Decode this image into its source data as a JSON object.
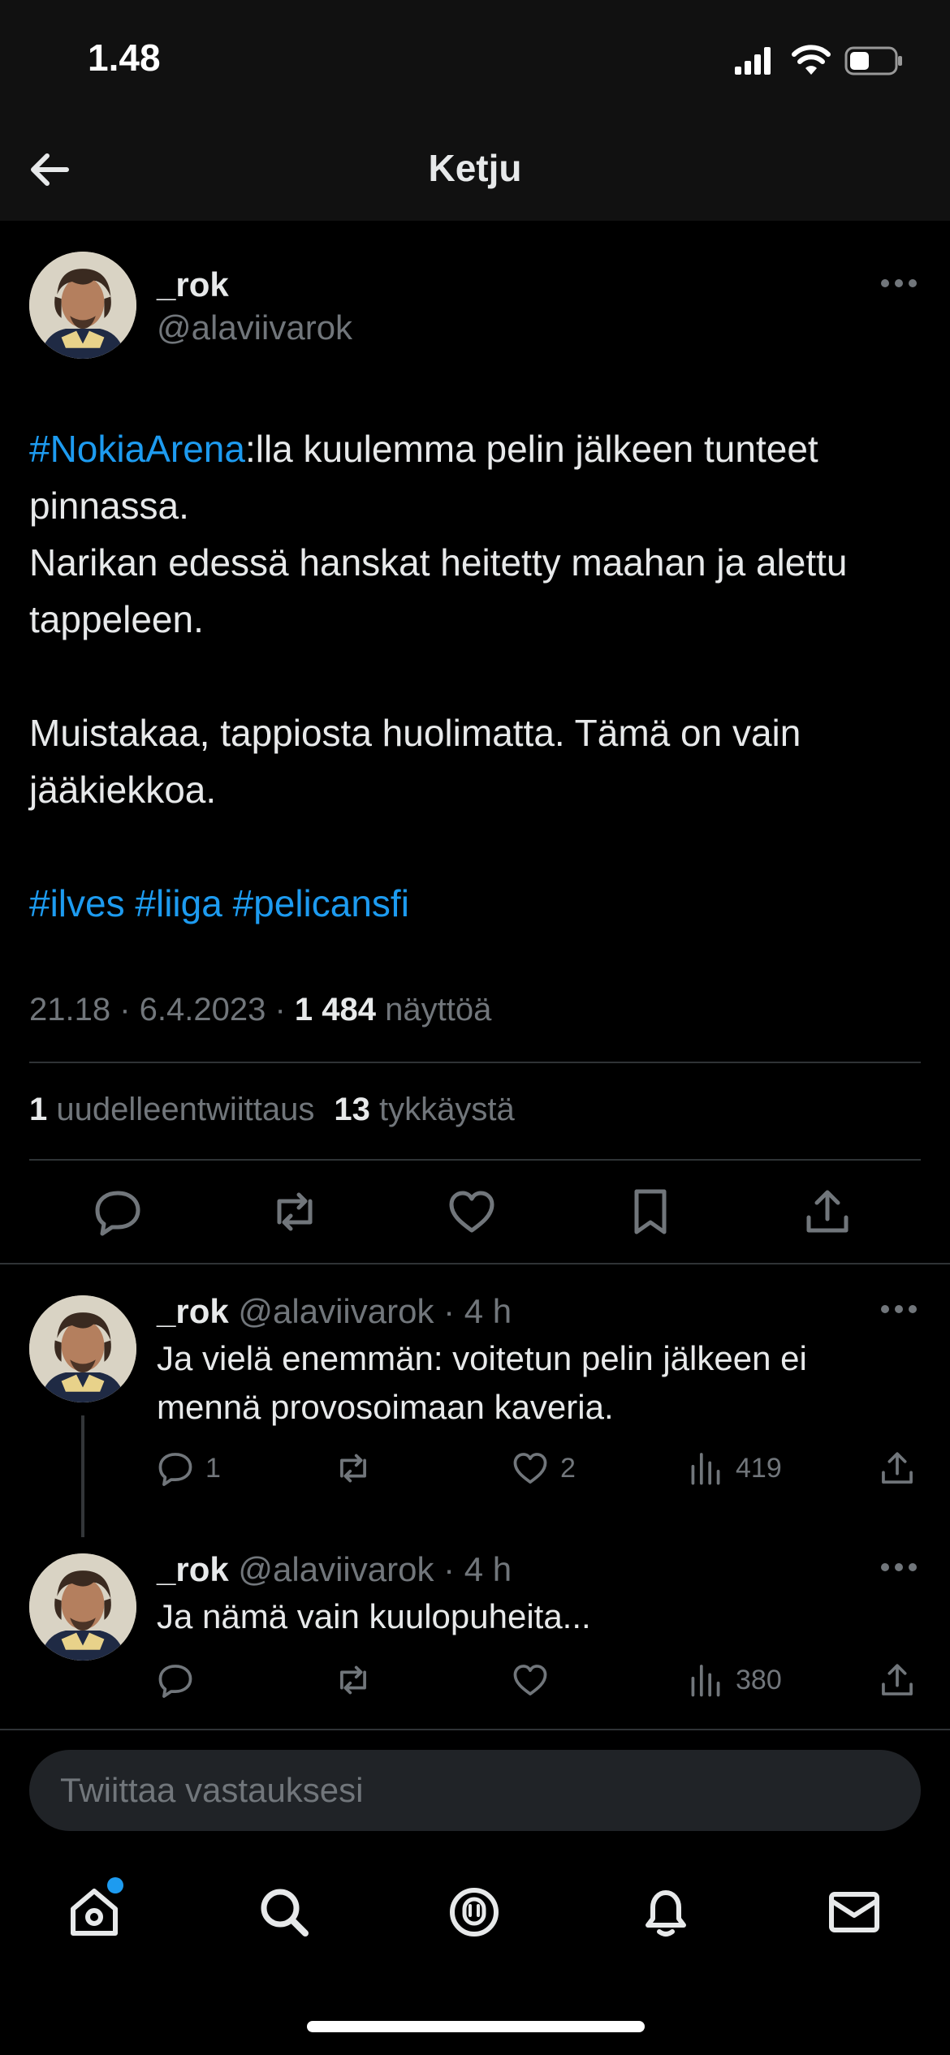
{
  "status_bar": {
    "time": "1.48",
    "battery_level": 0.45
  },
  "header": {
    "title": "Ketju",
    "back_icon": "arrow-left-icon"
  },
  "main_tweet": {
    "name": "_rok",
    "handle": "@alaviivarok",
    "text_parts": {
      "p1_hashtag": "#NokiaArena",
      "p1_text": ":lla kuulemma pelin jälkeen tunteet pinnassa.",
      "p2": "Narikan edessä hanskat heitetty maahan ja alettu tappeleen.",
      "p3": "Muistakaa, tappiosta huolimatta. Tämä on vain jääkiekkoa.",
      "p4_hashtags": "#ilves #liiga #pelicansfi"
    },
    "timestamp": "21.18 · 6.4.2023 · ",
    "views_count": "1 484",
    "views_label": " näyttöä",
    "retweets_count": "1",
    "retweets_label": " uudelleentwiittaus",
    "likes_count": "13",
    "likes_label": " tykkäystä"
  },
  "replies": [
    {
      "name": "_rok",
      "handle": "@alaviivarok",
      "time": "4 h",
      "text": "Ja vielä enemmän: voitetun pelin jälkeen ei mennä provosoimaan kaveria.",
      "reply_count": "1",
      "retweet_count": "",
      "like_count": "2",
      "view_count": "419"
    },
    {
      "name": "_rok",
      "handle": "@alaviivarok",
      "time": "4 h",
      "text": "Ja nämä vain kuulopuheita...",
      "reply_count": "",
      "retweet_count": "",
      "like_count": "",
      "view_count": "380"
    }
  ],
  "composer": {
    "placeholder": "Twiittaa vastauksesi"
  },
  "tab_bar": {
    "items": [
      "home-icon",
      "search-icon",
      "spaces-icon",
      "bell-icon",
      "mail-icon"
    ]
  },
  "colors": {
    "accent": "#1d9bf0",
    "background": "#000000",
    "muted": "#71767b",
    "text": "#e7e9ea"
  }
}
